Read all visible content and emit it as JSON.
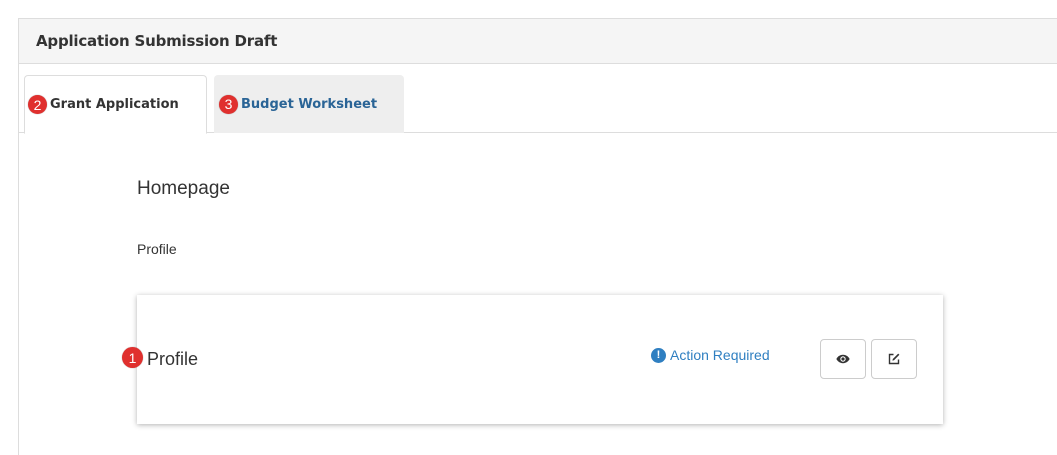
{
  "panel": {
    "title": "Application Submission Draft"
  },
  "tabs": [
    {
      "label": "Grant Application",
      "badge": "2",
      "active": true
    },
    {
      "label": "Budget Worksheet",
      "badge": "3",
      "active": false
    }
  ],
  "content": {
    "section_title": "Homepage",
    "sub_label": "Profile",
    "card": {
      "badge": "1",
      "title": "Profile",
      "status_icon": "!",
      "status_text": "Action Required",
      "view_icon": "eye-icon",
      "edit_icon": "edit-icon"
    }
  },
  "colors": {
    "accent": "#2f7fc1",
    "badge": "#e0302e",
    "tab_link": "#2a6496"
  }
}
